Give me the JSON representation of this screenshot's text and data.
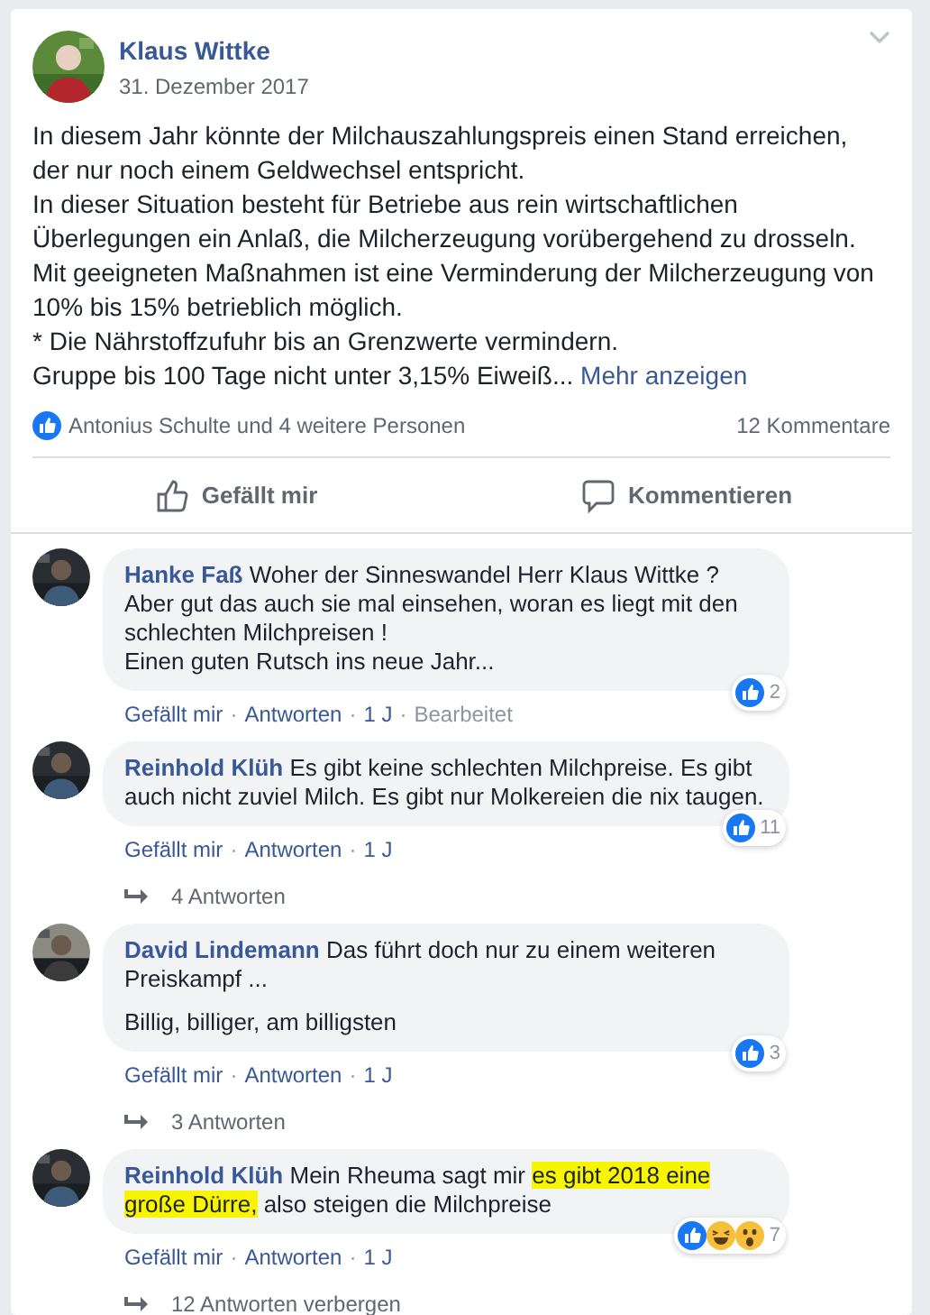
{
  "post": {
    "author": "Klaus Wittke",
    "date": "31. Dezember 2017",
    "body": [
      "In diesem Jahr könnte der Milchauszahlungspreis einen Stand erreichen, der nur noch einem Geldwechsel entspricht.",
      "In dieser Situation besteht für Betriebe aus rein wirtschaftlichen Überlegungen ein Anlaß, die Milcherzeugung vorübergehend zu drosseln.",
      "Mit geeigneten Maßnahmen ist eine Verminderung der Milcherzeugung von 10% bis 15% betrieblich möglich.",
      "* Die Nährstoffzufuhr bis an Grenzwerte vermindern.",
      "Gruppe bis 100 Tage nicht unter 3,15% Eiweiß..."
    ],
    "more_link": "Mehr anzeigen",
    "likes": "Antonius Schulte und 4 weitere Personen",
    "comment_count": "12 Kommentare",
    "actions": [
      {
        "kind": "like",
        "label": "Gefällt mir"
      },
      {
        "kind": "comment",
        "label": "Kommentieren"
      }
    ]
  },
  "comments": [
    {
      "author": "Hanke Faß",
      "paragraphs": [
        [
          {
            "text": "Woher der Sinneswandel Herr Klaus Wittke ?\nAber gut das auch sie mal einsehen, woran es liegt mit den schlechten Milchpreisen !\nEinen guten Rutsch ins neue Jahr...",
            "highlighted": false
          }
        ]
      ],
      "actions": [
        "Gefällt mir",
        "Antworten",
        "1 J"
      ],
      "separator": "·",
      "note": "Bearbeitet",
      "reactions": [
        {
          "kind": "like"
        }
      ],
      "reaction_count": "2"
    },
    {
      "author": "Reinhold Klüh",
      "paragraphs": [
        [
          {
            "text": "Es gibt keine schlechten Milchpreise. Es gibt auch nicht zuviel Milch. Es gibt nur Molkereien die nix taugen.",
            "highlighted": false
          }
        ]
      ],
      "actions": [
        "Gefällt mir",
        "Antworten",
        "1 J"
      ],
      "separator": "·",
      "reactions": [
        {
          "kind": "like"
        }
      ],
      "reaction_count": "11",
      "replies": "4 Antworten"
    },
    {
      "author": "David Lindemann",
      "paragraphs": [
        [
          {
            "text": "Das führt doch nur zu einem weiteren Preiskampf ...",
            "highlighted": false
          }
        ],
        [
          {
            "text": "Billig, billiger, am billigsten",
            "highlighted": false
          }
        ]
      ],
      "actions": [
        "Gefällt mir",
        "Antworten",
        "1 J"
      ],
      "separator": "·",
      "reactions": [
        {
          "kind": "like"
        }
      ],
      "reaction_count": "3",
      "replies": "3 Antworten"
    },
    {
      "author": "Reinhold Klüh",
      "paragraphs": [
        [
          {
            "text": "Mein Rheuma sagt mir ",
            "highlighted": false
          },
          {
            "text": "es gibt 2018 eine große Dürre,",
            "highlighted": true
          },
          {
            "text": " also steigen die Milchpreise",
            "highlighted": false
          }
        ]
      ],
      "actions": [
        "Gefällt mir",
        "Antworten",
        "1 J"
      ],
      "separator": "·",
      "reactions": [
        {
          "kind": "like"
        },
        {
          "kind": "haha"
        },
        {
          "kind": "wow"
        }
      ],
      "reaction_count": "7",
      "replies": "12 Antworten verbergen"
    }
  ]
}
